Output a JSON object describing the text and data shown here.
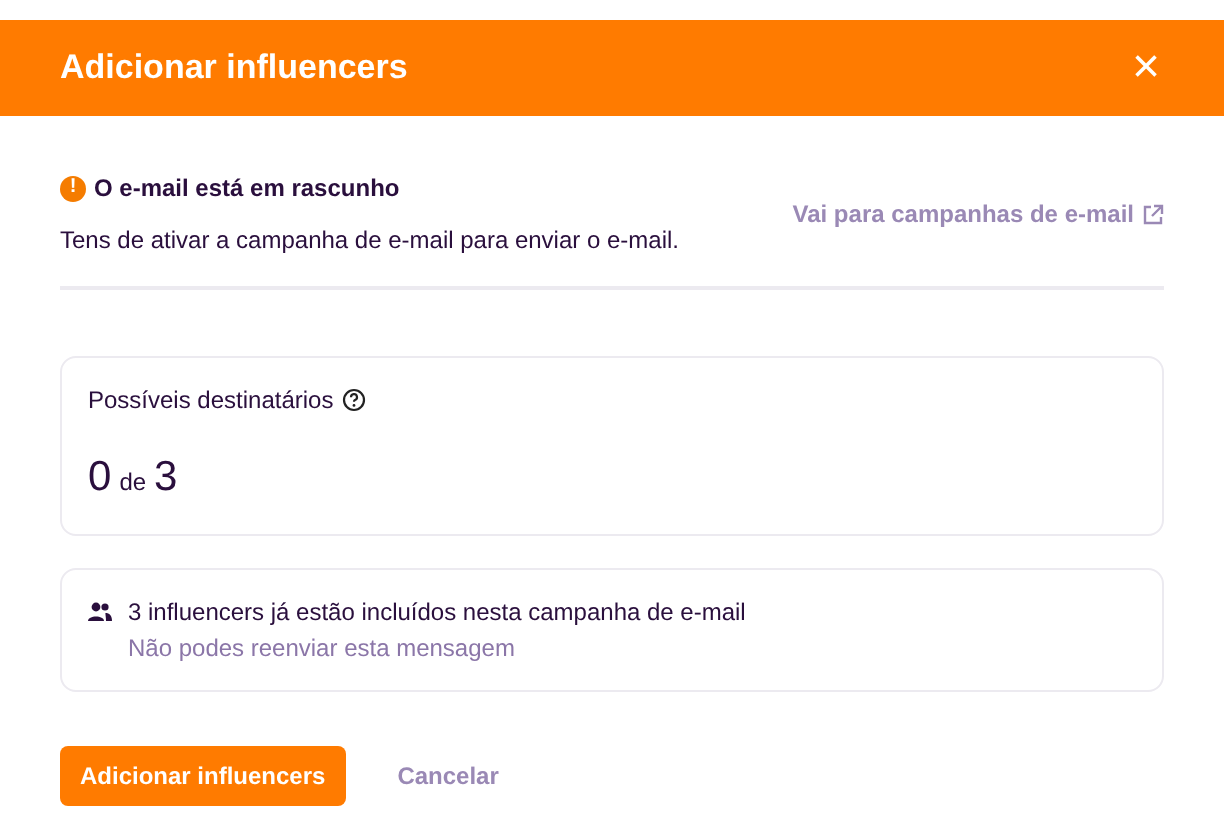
{
  "dialog": {
    "title": "Adicionar influencers",
    "close": "×"
  },
  "alert": {
    "icon": "!",
    "title": "O e-mail está em rascunho",
    "text": "Tens de ativar a campanha de e-mail para enviar o e-mail.",
    "link": "Vai para campanhas de e-mail"
  },
  "recipients": {
    "label": "Possíveis destinatários",
    "count": "0",
    "of": "de",
    "total": "3"
  },
  "notice": {
    "title": "3 influencers já estão incluídos nesta campanha de e-mail",
    "subtitle": "Não podes reenviar esta mensagem"
  },
  "buttons": [
    {
      "label": "Adicionar influencers",
      "kind": "primary"
    },
    {
      "label": "Cancelar",
      "kind": "link"
    }
  ]
}
